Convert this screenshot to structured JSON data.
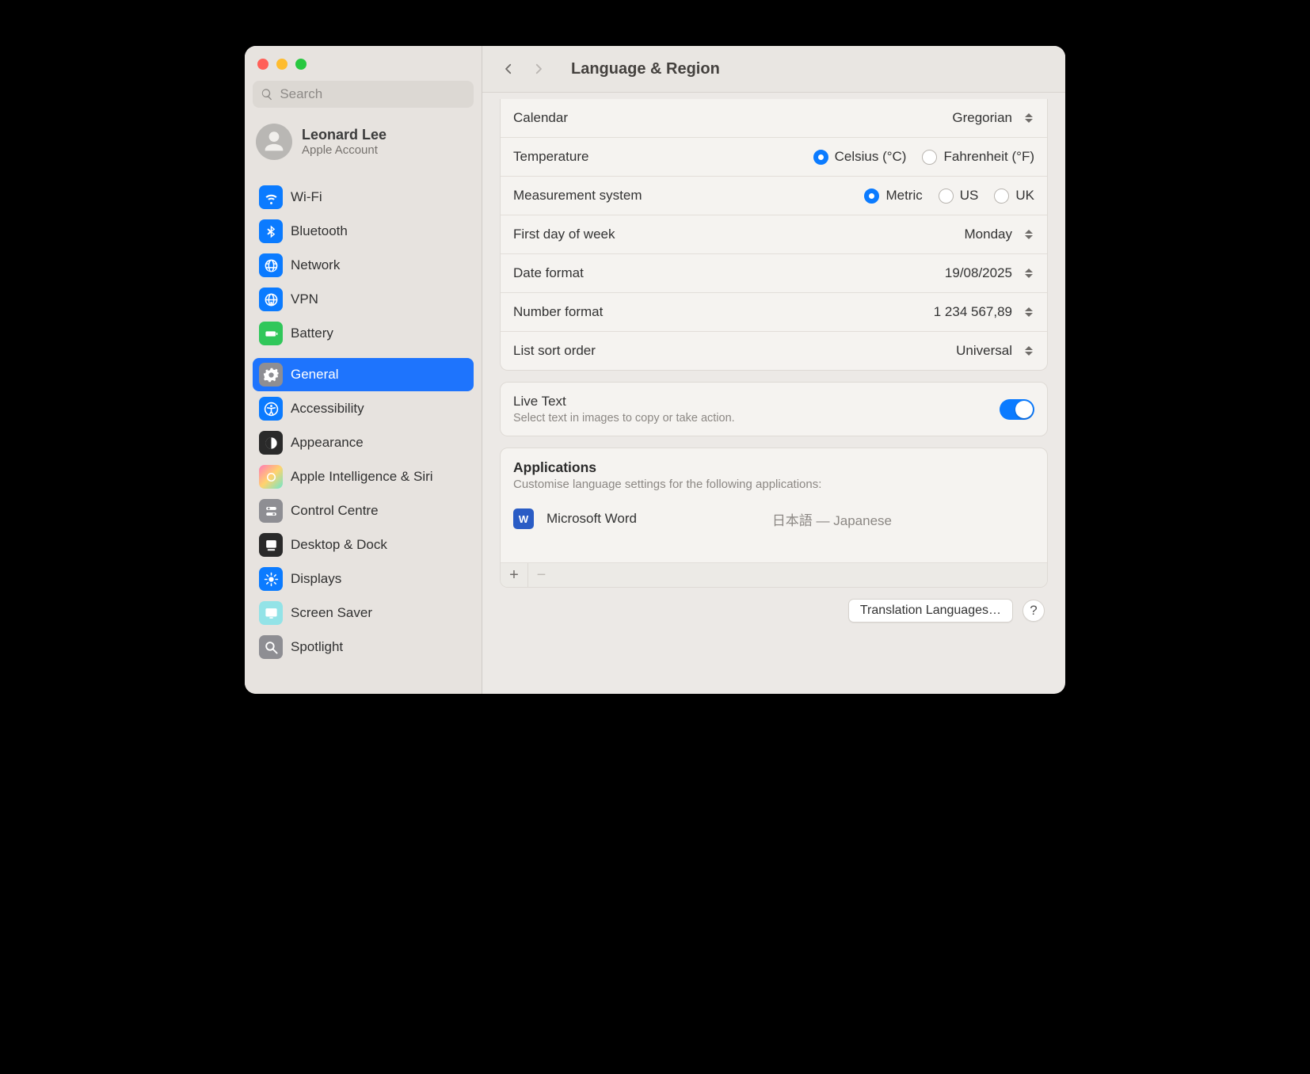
{
  "window": {
    "title": "Language & Region"
  },
  "search": {
    "placeholder": "Search"
  },
  "account": {
    "name": "Leonard Lee",
    "subtitle": "Apple Account"
  },
  "sidebar": {
    "groups": [
      {
        "items": [
          {
            "label": "Wi-Fi",
            "icon": "wifi-icon",
            "tint": "ic-blue"
          },
          {
            "label": "Bluetooth",
            "icon": "bluetooth-icon",
            "tint": "ic-blue"
          },
          {
            "label": "Network",
            "icon": "globe-icon",
            "tint": "ic-blue"
          },
          {
            "label": "VPN",
            "icon": "vpn-icon",
            "tint": "ic-blue"
          },
          {
            "label": "Battery",
            "icon": "battery-icon",
            "tint": "ic-green"
          }
        ]
      },
      {
        "items": [
          {
            "label": "General",
            "icon": "gear-icon",
            "tint": "ic-gray",
            "selected": true
          },
          {
            "label": "Accessibility",
            "icon": "accessibility-icon",
            "tint": "ic-blue"
          },
          {
            "label": "Appearance",
            "icon": "appearance-icon",
            "tint": "ic-black"
          },
          {
            "label": "Apple Intelligence & Siri",
            "icon": "ai-icon",
            "tint": "ic-grad"
          },
          {
            "label": "Control Centre",
            "icon": "control-centre-icon",
            "tint": "ic-gray"
          },
          {
            "label": "Desktop & Dock",
            "icon": "desktop-dock-icon",
            "tint": "ic-black"
          },
          {
            "label": "Displays",
            "icon": "displays-icon",
            "tint": "ic-blue"
          },
          {
            "label": "Screen Saver",
            "icon": "screensaver-icon",
            "tint": "ic-cyan"
          },
          {
            "label": "Spotlight",
            "icon": "spotlight-icon",
            "tint": "ic-gray"
          }
        ]
      }
    ]
  },
  "settings": {
    "calendar": {
      "label": "Calendar",
      "value": "Gregorian"
    },
    "temperature": {
      "label": "Temperature",
      "options": [
        "Celsius (°C)",
        "Fahrenheit (°F)"
      ],
      "selected": "Celsius (°C)"
    },
    "measurement": {
      "label": "Measurement system",
      "options": [
        "Metric",
        "US",
        "UK"
      ],
      "selected": "Metric"
    },
    "first_day": {
      "label": "First day of week",
      "value": "Monday"
    },
    "date_format": {
      "label": "Date format",
      "value": "19/08/2025"
    },
    "number_format": {
      "label": "Number format",
      "value": "1 234 567,89"
    },
    "list_sort": {
      "label": "List sort order",
      "value": "Universal"
    }
  },
  "live_text": {
    "label": "Live Text",
    "sub": "Select text in images to copy or take action.",
    "on": true
  },
  "applications": {
    "title": "Applications",
    "sub": "Customise language settings for the following applications:",
    "items": [
      {
        "name": "Microsoft Word",
        "language": "日本語 — Japanese"
      }
    ]
  },
  "footer": {
    "translation_btn": "Translation Languages…"
  }
}
